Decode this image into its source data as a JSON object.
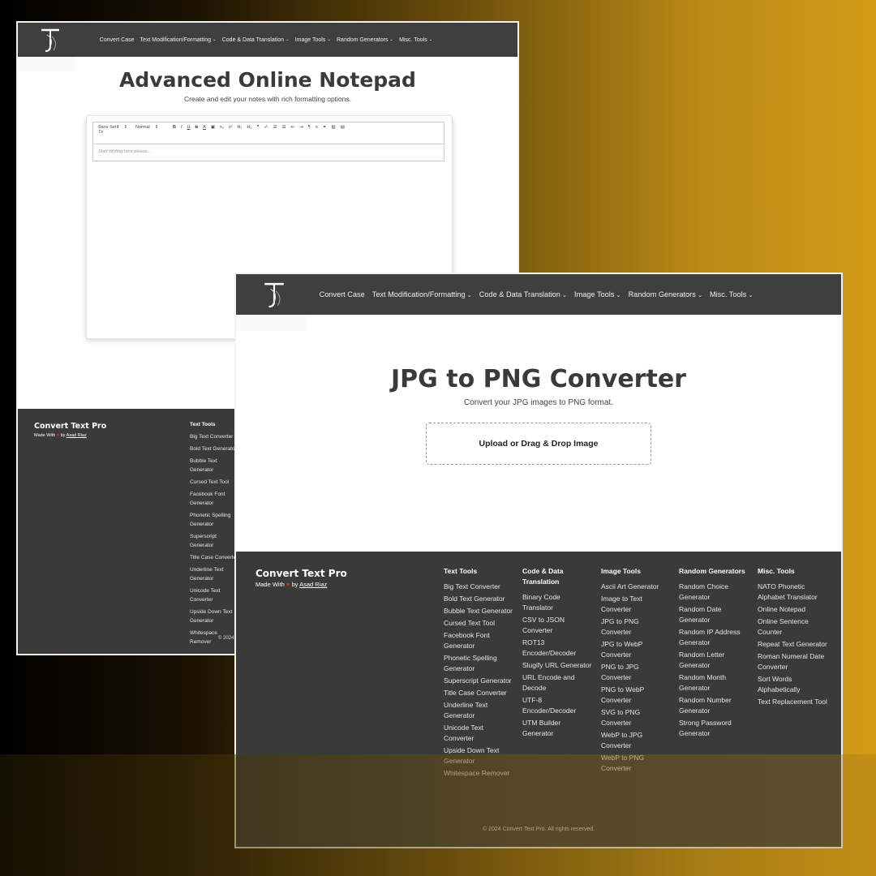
{
  "nav": {
    "items": [
      {
        "label": "Convert Case",
        "dropdown": false
      },
      {
        "label": "Text Modification/Formatting",
        "dropdown": true
      },
      {
        "label": "Code & Data Translation",
        "dropdown": true
      },
      {
        "label": "Image Tools",
        "dropdown": true
      },
      {
        "label": "Random Generators",
        "dropdown": true
      },
      {
        "label": "Misc. Tools",
        "dropdown": true
      }
    ],
    "chevron": "⌄"
  },
  "window1": {
    "title": "Advanced Online Notepad",
    "subtitle": "Create and edit your notes with rich formatting options.",
    "editor": {
      "font_select": "Sans Serif",
      "size_select": "Normal",
      "placeholder": "Start Writing here please...",
      "clear_format_glyph": "Tx"
    },
    "footer": {
      "text_tools_visible": [
        "Big Text Converter",
        "Bold Text Generator",
        "Bubble Text Generator",
        "Cursed Text Tool",
        "Facebook Font Generator",
        "Phonetic Spelling Generator",
        "Superscript Generator",
        "Title Case Converter",
        "Underline Text Generator",
        "Unicode Text Converter",
        "Upside Down Text Generator",
        "Whitespace Remover"
      ],
      "copyright_partial": "© 2024"
    }
  },
  "window2": {
    "title": "JPG to PNG Converter",
    "subtitle": "Convert your JPG images to PNG format.",
    "upload_label": "Upload or Drag & Drop Image"
  },
  "footer": {
    "brand": "Convert Text Pro",
    "made_with": "Made With",
    "by": "by",
    "author": "Asad Riaz",
    "copyright": "© 2024 Convert Text Pro. All rights reserved.",
    "columns": [
      {
        "title": "Text Tools",
        "items": [
          "Big Text Converter",
          "Bold Text Generator",
          "Bubble Text Generator",
          "Cursed Text Tool",
          "Facebook Font Generator",
          "Phonetic Spelling Generator",
          "Superscript Generator",
          "Title Case Converter",
          "Underline Text Generator",
          "Unicode Text Converter",
          "Upside Down Text Generator",
          "Whitespace Remover"
        ]
      },
      {
        "title": "Code & Data Translation",
        "items": [
          "Binary Code Translator",
          "CSV to JSON Converter",
          "ROT13 Encoder/Decoder",
          "Slugify URL Generator",
          "URL Encode and Decode",
          "UTF-8 Encoder/Decoder",
          "UTM Builder Generator"
        ]
      },
      {
        "title": "Image Tools",
        "items": [
          "Ascii Art Generator",
          "Image to Text Converter",
          "JPG to PNG Converter",
          "JPG to WebP Converter",
          "PNG to JPG Converter",
          "PNG to WebP Converter",
          "SVG to PNG Converter",
          "WebP to JPG Converter",
          "WebP to PNG Converter"
        ]
      },
      {
        "title": "Random Generators",
        "items": [
          "Random Choice Generator",
          "Random Date Generator",
          "Random IP Address Generator",
          "Random Letter Generator",
          "Random Month Generator",
          "Random Number Generator",
          "Strong Password Generator"
        ]
      },
      {
        "title": "Misc. Tools",
        "items": [
          "NATO Phonetic Alphabet Translator",
          "Online Notepad",
          "Online Sentence Counter",
          "Repeat Text Generator",
          "Roman Numeral Date Converter",
          "Sort Words Alphabetically",
          "Text Replacement Tool"
        ]
      }
    ]
  },
  "colors": {
    "nav_bg": "#3f3f3f",
    "footer_bg": "#3a3a3a",
    "heart": "#e02424",
    "background_gold": "#d39b18"
  },
  "icons": {
    "logo": "stylized-T-logo-icon",
    "heart": "heart-icon"
  }
}
